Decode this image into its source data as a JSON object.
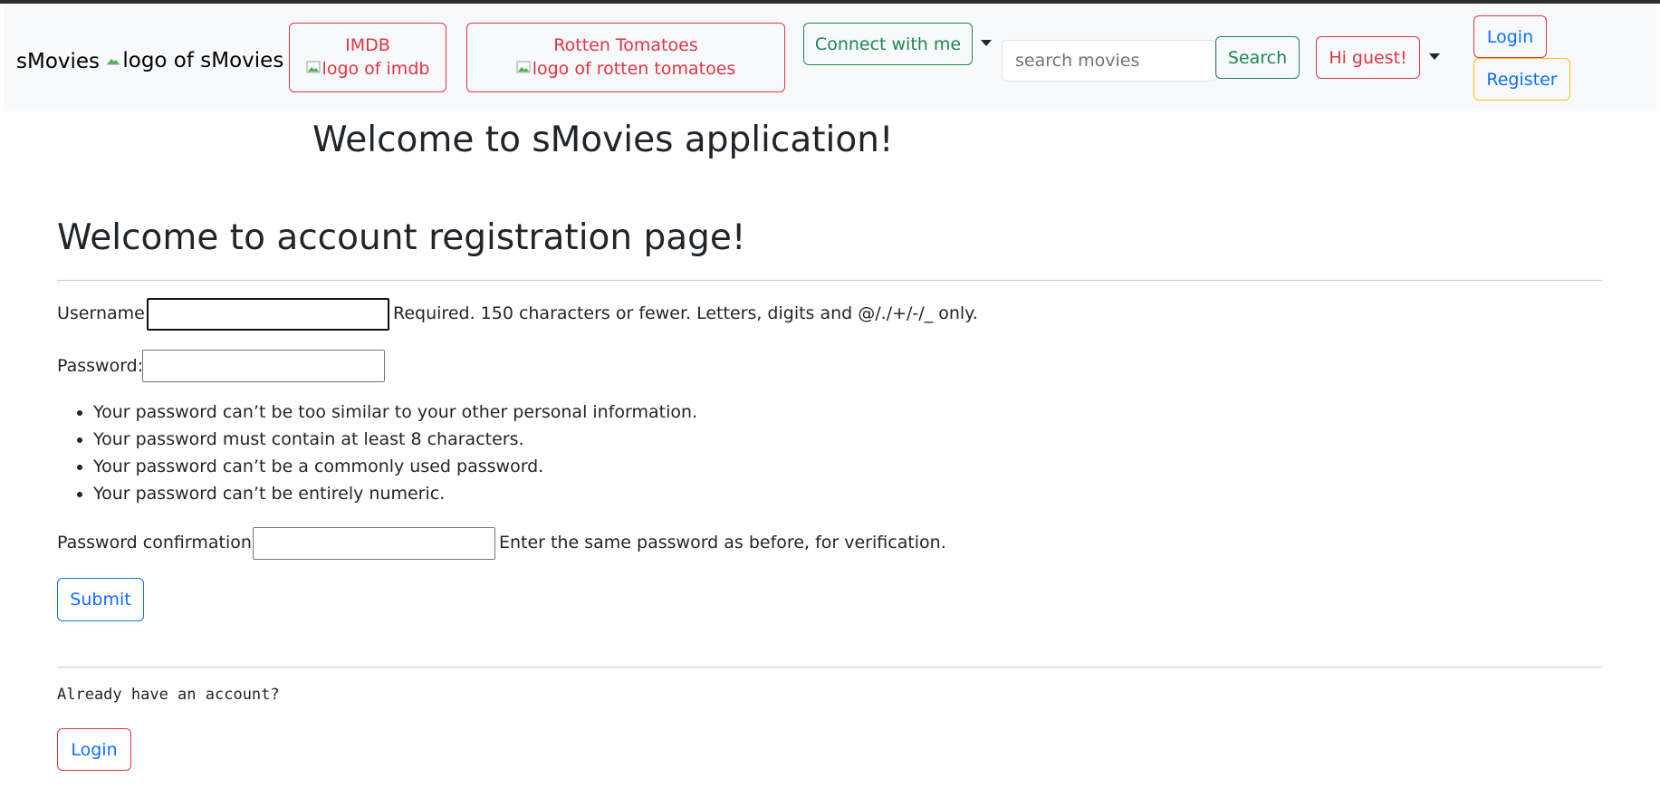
{
  "navbar": {
    "brand_text": "sMovies",
    "brand_logo_alt": "logo of sMovies",
    "imdb": {
      "label": "IMDB",
      "logo_alt": "logo of imdb"
    },
    "rotten_tomatoes": {
      "label": "Rotten Tomatoes",
      "logo_alt": "logo of rotten tomatoes"
    },
    "connect_label": "Connect with me",
    "search_placeholder": "search movies",
    "search_value": "",
    "search_button": "Search",
    "greeting": "Hi guest!",
    "login_label": "Login",
    "register_label": "Register"
  },
  "app_title": "Welcome to sMovies application!",
  "page_title": "Welcome to account registration page!",
  "form": {
    "username": {
      "label": "Username:",
      "value": "",
      "help": "Required. 150 characters or fewer. Letters, digits and @/./+/-/_ only."
    },
    "password": {
      "label": "Password:",
      "value": "",
      "rules": [
        "Your password can’t be too similar to your other personal information.",
        "Your password must contain at least 8 characters.",
        "Your password can’t be a commonly used password.",
        "Your password can’t be entirely numeric."
      ]
    },
    "password_confirmation": {
      "label": "Password confirmation:",
      "value": "",
      "help": "Enter the same password as before, for verification."
    },
    "submit_label": "Submit"
  },
  "footer": {
    "already_text": "Already have an account?",
    "login_label": "Login"
  },
  "colors": {
    "danger": "#dc3545",
    "success": "#198754",
    "primary": "#0d6efd",
    "warning": "#ffc107",
    "navbar_bg": "#f8f9fa"
  },
  "icons": {
    "broken_image": "broken-image-icon",
    "dropdown_caret": "caret-down-icon"
  }
}
